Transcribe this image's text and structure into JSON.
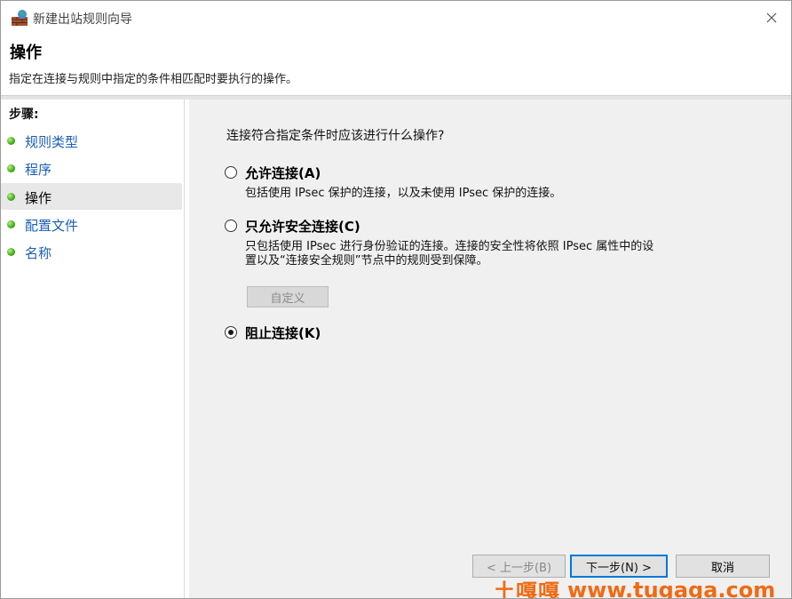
{
  "window": {
    "title": "新建出站规则向导"
  },
  "header": {
    "title": "操作",
    "description": "指定在连接与规则中指定的条件相匹配时要执行的操作。"
  },
  "steps": {
    "title": "步骤:",
    "items": [
      {
        "label": "规则类型"
      },
      {
        "label": "程序"
      },
      {
        "label": "操作"
      },
      {
        "label": "配置文件"
      },
      {
        "label": "名称"
      }
    ]
  },
  "content": {
    "question": "连接符合指定条件时应该进行什么操作?",
    "options": [
      {
        "label": "允许连接(A)",
        "desc": [
          "包括使用 IPsec 保护的连接，以及未使用 IPsec 保护的连接。"
        ],
        "checked": false
      },
      {
        "label": "只允许安全连接(C)",
        "desc": [
          "只包括使用 IPsec 进行身份验证的连接。连接的安全性将依照 IPsec 属性中的设",
          "置以及“连接安全规则”节点中的规则受到保障。"
        ],
        "checked": false
      },
      {
        "label": "阻止连接(K)",
        "desc": [],
        "checked": true
      }
    ],
    "custom_button": "自定义"
  },
  "buttons": {
    "back": "< 上一步(B)",
    "next": "下一步(N) >",
    "cancel": "取消"
  },
  "watermark": {
    "cn": "土嘎嘎",
    "url": "www.tugaga.com"
  }
}
